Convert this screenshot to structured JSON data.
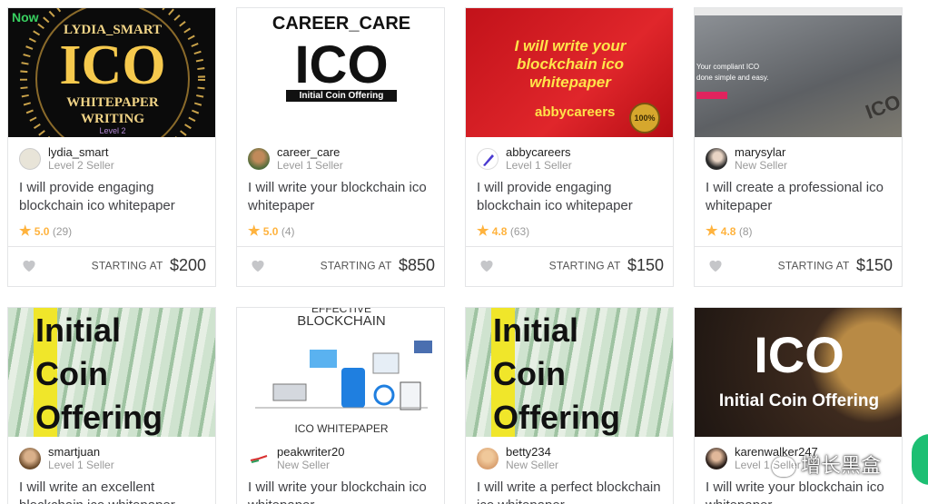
{
  "gigs": [
    {
      "thumb_text": {
        "line1": "LYDIA_SMART",
        "line2": "ICO",
        "line3": "WHITEPAPER",
        "line4": "WRITING",
        "badge": "Now",
        "sub": "Level 2"
      },
      "seller": "lydia_smart",
      "level": "Level 2 Seller",
      "title": "I will provide engaging blockchain ico whitepaper",
      "rating": "5.0",
      "count": "(29)",
      "starting": "STARTING AT",
      "price": "$200"
    },
    {
      "thumb_text": {
        "line1": "CAREER_CARE",
        "line2": "ICO",
        "line3": "Initial Coin Offering"
      },
      "seller": "career_care",
      "level": "Level 1 Seller",
      "title": "I will write your blockchain ico whitepaper",
      "rating": "5.0",
      "count": "(4)",
      "starting": "STARTING AT",
      "price": "$850"
    },
    {
      "thumb_text": {
        "line1": "I will write your",
        "line2": "blockchain ico",
        "line3": "whitepaper",
        "line4": "abbycareers",
        "badge": "100%"
      },
      "seller": "abbycareers",
      "level": "Level 1 Seller",
      "title": "I will provide engaging blockchain ico whitepaper",
      "rating": "4.8",
      "count": "(63)",
      "starting": "STARTING AT",
      "price": "$150"
    },
    {
      "thumb_text": {
        "line1": "Your compliant ICO",
        "line2": "done simple and easy.",
        "line3": "ICO"
      },
      "seller": "marysylar",
      "level": "New Seller",
      "title": "I will create a professional ico whitepaper",
      "rating": "4.8",
      "count": "(8)",
      "starting": "STARTING AT",
      "price": "$150"
    },
    {
      "thumb_text": {
        "l1a": "I",
        "l1b": "nitial",
        "l2a": "C",
        "l2b": "oin",
        "l3a": "O",
        "l3b": "ffering"
      },
      "seller": "smartjuan",
      "level": "Level 1 Seller",
      "title": "I will write an excellent blockchain ico whitepaper"
    },
    {
      "thumb_text": {
        "line0": "EFFECTIVE",
        "line1": "BLOCKCHAIN",
        "line2": "ICO WHITEPAPER"
      },
      "seller": "peakwriter20",
      "level": "New Seller",
      "title": "I will write your blockchain ico whitepaper"
    },
    {
      "thumb_text": {
        "l1a": "I",
        "l1b": "nitial",
        "l2a": "C",
        "l2b": "oin",
        "l3a": "O",
        "l3b": "ffering"
      },
      "seller": "betty234",
      "level": "New Seller",
      "title": "I will write a perfect blockchain ico whitepaper"
    },
    {
      "thumb_text": {
        "line1": "ICO",
        "line2": "Initial Coin Offering"
      },
      "seller": "karenwalker247",
      "level": "Level 1 Seller",
      "title": "I will write your blockchain ico whitepaper"
    }
  ],
  "watermark": "增长黑盒",
  "colors": {
    "star": "#ffb33e",
    "muted": "#9a9a9a",
    "fab": "#1dbf73"
  }
}
